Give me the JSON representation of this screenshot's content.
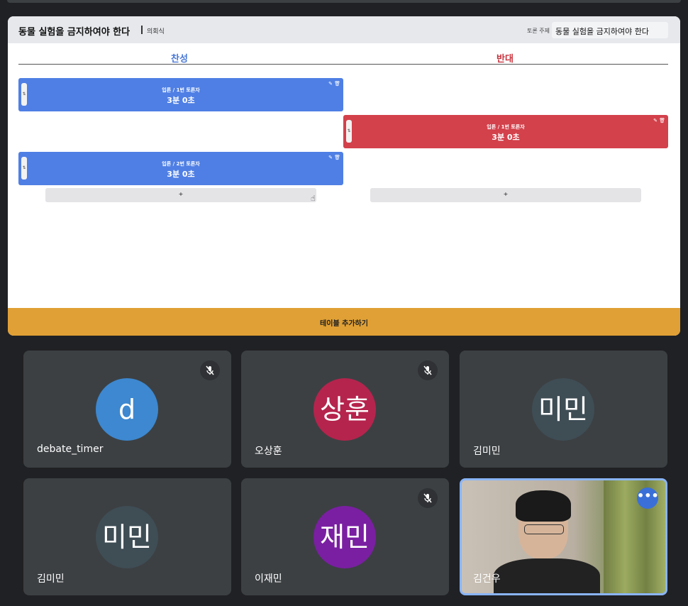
{
  "share": {
    "title": "동물 실험을 금지하여야 한다",
    "subtitle": "의회식",
    "topic_label": "토론 주제",
    "topic_value": "동물 실험을 금지하여야 한다",
    "pro_label": "찬성",
    "con_label": "반대",
    "cards": [
      {
        "side": "pro",
        "role": "입론 / 1번 토론자",
        "time": "3분 0초"
      },
      {
        "side": "con",
        "role": "입론 / 1번 토론자",
        "time": "3분 0초"
      },
      {
        "side": "pro",
        "role": "입론 / 2번 토론자",
        "time": "3분 0초"
      }
    ],
    "add_pro": "+",
    "add_con": "+",
    "add_table": "테이블 추가하기",
    "handle_glyph": "⇅",
    "edit_glyph": "✎",
    "delete_glyph": "🗑"
  },
  "participants": [
    {
      "name": "debate_timer",
      "initials": "d",
      "color": "#3d88d0",
      "muted": true
    },
    {
      "name": "오상훈",
      "initials": "상훈",
      "color": "#b5244d",
      "muted": true
    },
    {
      "name": "김미민",
      "initials": "미민",
      "color": "#3f4d55",
      "muted": false
    },
    {
      "name": "김미민",
      "initials": "미민",
      "color": "#3f4d55",
      "muted": false
    },
    {
      "name": "이재민",
      "initials": "재민",
      "color": "#7a1fa2",
      "muted": true
    },
    {
      "name": "김건우",
      "video": true,
      "more_glyph": "•••"
    }
  ]
}
